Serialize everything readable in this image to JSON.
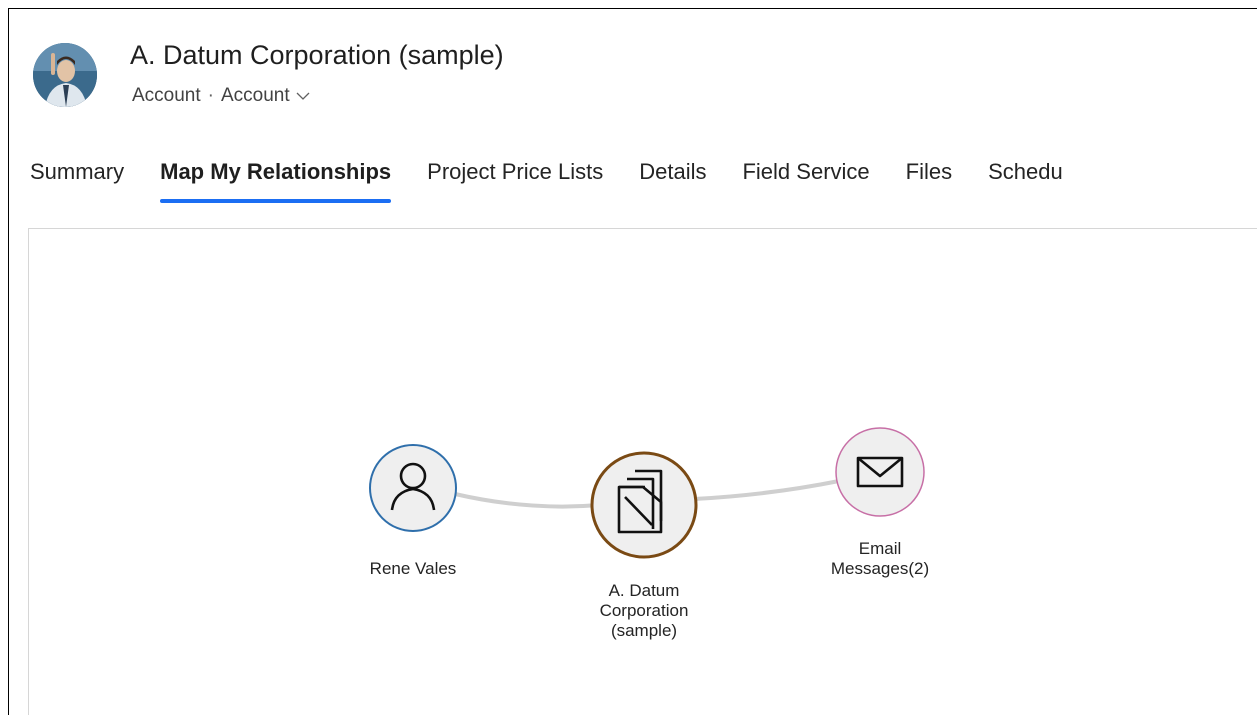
{
  "record": {
    "title": "A. Datum Corporation (sample)",
    "entity": "Account",
    "form": "Account"
  },
  "tabs": [
    {
      "label": "Summary",
      "active": false
    },
    {
      "label": "Map My Relationships",
      "active": true
    },
    {
      "label": "Project Price Lists",
      "active": false
    },
    {
      "label": "Details",
      "active": false
    },
    {
      "label": "Field Service",
      "active": false
    },
    {
      "label": "Files",
      "active": false
    },
    {
      "label": "Schedu",
      "active": false
    }
  ],
  "graph": {
    "nodes": [
      {
        "label": "Rene Vales",
        "icon": "person-icon",
        "ring_color": "#2f6fab"
      },
      {
        "label": "A. Datum\nCorporation\n(sample)",
        "icon": "account-folders-icon",
        "ring_color": "#7a4a14"
      },
      {
        "label": "Email\nMessages(2)",
        "icon": "envelope-icon",
        "ring_color": "#c76fa6"
      }
    ]
  }
}
